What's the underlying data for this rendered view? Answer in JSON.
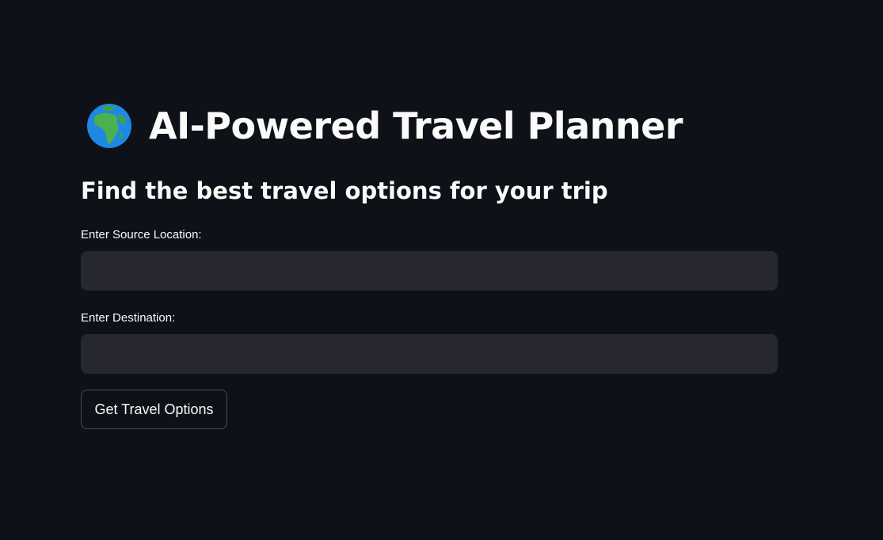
{
  "header": {
    "icon": "globe-africa-icon",
    "title": "AI-Powered Travel Planner"
  },
  "subheader": {
    "text": "Find the best travel options for your trip"
  },
  "form": {
    "source": {
      "label": "Enter Source Location:",
      "value": "",
      "placeholder": ""
    },
    "destination": {
      "label": "Enter Destination:",
      "value": "",
      "placeholder": ""
    },
    "submit_label": "Get Travel Options"
  },
  "colors": {
    "background": "#0e1117",
    "input_background": "#262730",
    "text": "#fafafa",
    "button_border": "#4a4c56",
    "globe_ocean": "#1e88e5",
    "globe_land": "#4caf50"
  }
}
